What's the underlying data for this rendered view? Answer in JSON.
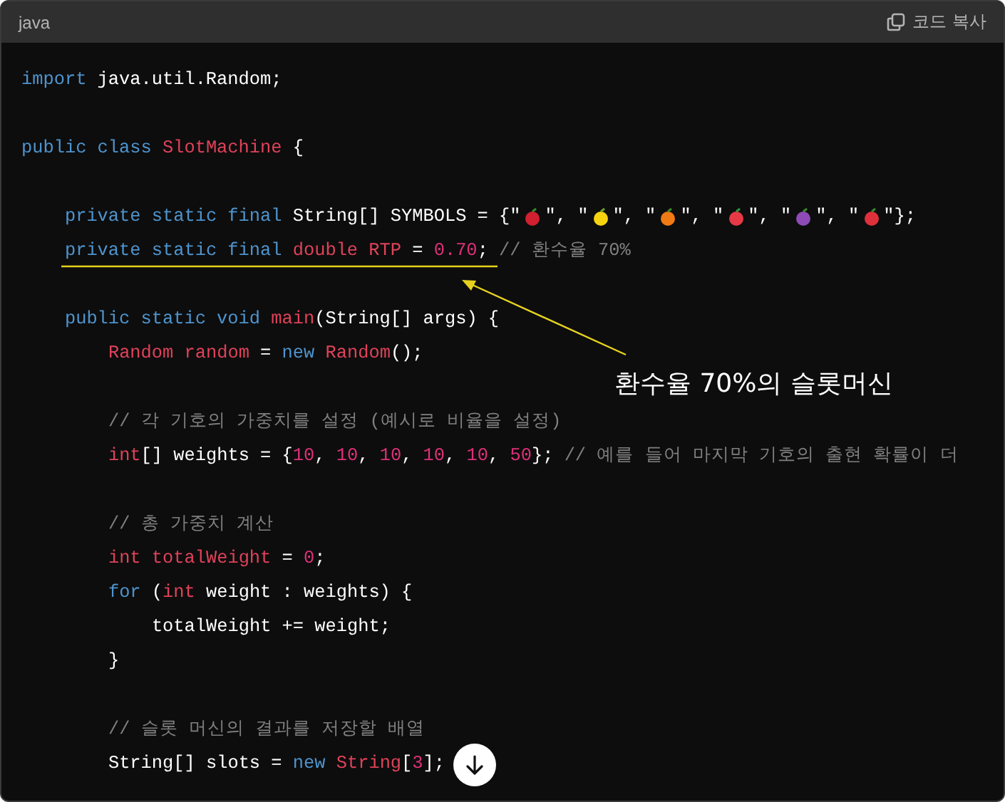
{
  "header": {
    "language": "java",
    "copy_label": "코드 복사"
  },
  "code_lines": [
    {
      "kind": "code",
      "tokens": [
        {
          "kind": "kw",
          "text": "import "
        },
        {
          "kind": "plain",
          "text": "java.util.Random;"
        }
      ]
    },
    {
      "kind": "blank"
    },
    {
      "kind": "code",
      "tokens": [
        {
          "kind": "kw",
          "text": "public class "
        },
        {
          "kind": "type",
          "text": "SlotMachine"
        },
        {
          "kind": "plain",
          "text": " {"
        }
      ],
      "children": [
        {
          "kind": "blank"
        },
        {
          "kind": "code",
          "tokens": [
            {
              "kind": "kw",
              "text": "private static final "
            },
            {
              "kind": "plain",
              "text": "String[] SYMBOLS = {\""
            },
            {
              "kind": "icon"
            },
            {
              "kind": "plain",
              "text": "\", \""
            },
            {
              "kind": "icon"
            },
            {
              "kind": "plain",
              "text": "\", \""
            },
            {
              "kind": "icon"
            },
            {
              "kind": "plain",
              "text": "\", \""
            },
            {
              "kind": "icon"
            },
            {
              "kind": "plain",
              "text": "\", \""
            },
            {
              "kind": "icon"
            },
            {
              "kind": "plain",
              "text": "\", \""
            },
            {
              "kind": "icon"
            },
            {
              "kind": "plain",
              "text": "\"};"
            }
          ]
        },
        {
          "kind": "code",
          "tokens": [
            {
              "kind": "kw",
              "text": "private static final "
            },
            {
              "kind": "type",
              "text": "double RTP"
            },
            {
              "kind": "plain",
              "text": " = "
            },
            {
              "kind": "num",
              "text": "0.70"
            },
            {
              "kind": "plain",
              "text": "; "
            },
            {
              "kind": "comment",
              "text": "// 환수율 70%"
            }
          ]
        },
        {
          "kind": "blank"
        },
        {
          "kind": "code",
          "tokens": [
            {
              "kind": "kw",
              "text": "public static void "
            },
            {
              "kind": "type",
              "text": "main"
            },
            {
              "kind": "plain",
              "text": "(String[] args) {"
            }
          ],
          "children": [
            {
              "kind": "code",
              "tokens": [
                {
                  "kind": "type",
                  "text": "Random random"
                },
                {
                  "kind": "plain",
                  "text": " = "
                },
                {
                  "kind": "kw",
                  "text": "new "
                },
                {
                  "kind": "type",
                  "text": "Random"
                },
                {
                  "kind": "plain",
                  "text": "();"
                }
              ]
            },
            {
              "kind": "blank"
            },
            {
              "kind": "code",
              "tokens": [
                {
                  "kind": "comment",
                  "text": "// 각 기호의 가중치를 설정 (예시로 비율을 설정)"
                }
              ]
            },
            {
              "kind": "code",
              "tokens": [
                {
                  "kind": "type",
                  "text": "int"
                },
                {
                  "kind": "plain",
                  "text": "[] weights = {"
                },
                {
                  "kind": "num",
                  "text": "10"
                },
                {
                  "kind": "plain",
                  "text": ", "
                },
                {
                  "kind": "num",
                  "text": "10"
                },
                {
                  "kind": "plain",
                  "text": ", "
                },
                {
                  "kind": "num",
                  "text": "10"
                },
                {
                  "kind": "plain",
                  "text": ", "
                },
                {
                  "kind": "num",
                  "text": "10"
                },
                {
                  "kind": "plain",
                  "text": ", "
                },
                {
                  "kind": "num",
                  "text": "10"
                },
                {
                  "kind": "plain",
                  "text": ", "
                },
                {
                  "kind": "num",
                  "text": "50"
                },
                {
                  "kind": "plain",
                  "text": "}; "
                },
                {
                  "kind": "comment",
                  "text": "// 예를 들어 마지막 기호의 출현 확률이 더"
                }
              ]
            },
            {
              "kind": "blank"
            },
            {
              "kind": "code",
              "tokens": [
                {
                  "kind": "comment",
                  "text": "// 총 가중치 계산"
                }
              ]
            },
            {
              "kind": "code",
              "tokens": [
                {
                  "kind": "type",
                  "text": "int totalWeight"
                },
                {
                  "kind": "plain",
                  "text": " = "
                },
                {
                  "kind": "num",
                  "text": "0"
                },
                {
                  "kind": "plain",
                  "text": ";"
                }
              ]
            },
            {
              "kind": "code",
              "tokens": [
                {
                  "kind": "kw",
                  "text": "for"
                },
                {
                  "kind": "plain",
                  "text": " ("
                },
                {
                  "kind": "type",
                  "text": "int"
                },
                {
                  "kind": "plain",
                  "text": " weight : weights) {"
                }
              ],
              "children": [
                {
                  "kind": "code",
                  "tokens": [
                    {
                      "kind": "plain",
                      "text": "totalWeight += weight;"
                    }
                  ]
                }
              ]
            },
            {
              "kind": "code",
              "tokens": [
                {
                  "kind": "plain",
                  "text": "}"
                }
              ]
            },
            {
              "kind": "blank"
            },
            {
              "kind": "code",
              "tokens": [
                {
                  "kind": "comment",
                  "text": "// 슬롯 머신의 결과를 저장할 배열"
                }
              ]
            },
            {
              "kind": "code",
              "tokens": [
                {
                  "kind": "plain",
                  "text": "String[] slots = "
                },
                {
                  "kind": "kw",
                  "text": "new "
                },
                {
                  "kind": "type",
                  "text": "String"
                },
                {
                  "kind": "plain",
                  "text": "["
                },
                {
                  "kind": "num",
                  "text": "3"
                },
                {
                  "kind": "plain",
                  "text": "];"
                }
              ]
            }
          ]
        }
      ]
    }
  ],
  "annotation": {
    "label": "환수율 70%의 슬롯머신"
  }
}
